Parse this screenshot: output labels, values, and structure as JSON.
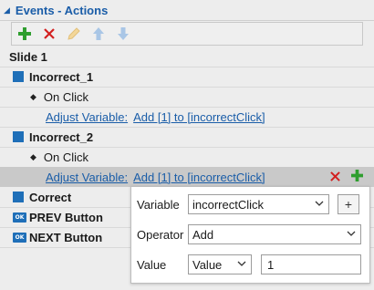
{
  "panel": {
    "title": "Events - Actions"
  },
  "toolbar": {
    "add_icon": "plus-icon",
    "delete_icon": "x-icon",
    "edit_icon": "pencil-icon",
    "up_icon": "arrow-up-icon",
    "down_icon": "arrow-down-icon"
  },
  "tree": {
    "slide_label": "Slide 1",
    "incorrect1": {
      "name": "Incorrect_1",
      "event": "On Click",
      "action_label": "Adjust Variable:",
      "action_value": "Add [1] to [incorrectClick]"
    },
    "incorrect2": {
      "name": "Incorrect_2",
      "event": "On Click",
      "action_label": "Adjust Variable:",
      "action_value": "Add [1] to [incorrectClick]"
    },
    "correct": {
      "name": "Correct"
    },
    "prev": {
      "name": "PREV Button",
      "icon_text": "OK"
    },
    "next": {
      "name": "NEXT Button",
      "icon_text": "OK"
    }
  },
  "popup": {
    "variable_label": "Variable",
    "variable_value": "incorrectClick",
    "add_button": "+",
    "operator_label": "Operator",
    "operator_value": "Add",
    "value_label": "Value",
    "value_type": "Value",
    "value": "1"
  },
  "colors": {
    "accent": "#1a5da8",
    "object_square": "#1f6fb8",
    "add_green": "#2f9e2f",
    "delete_red": "#d32020"
  }
}
